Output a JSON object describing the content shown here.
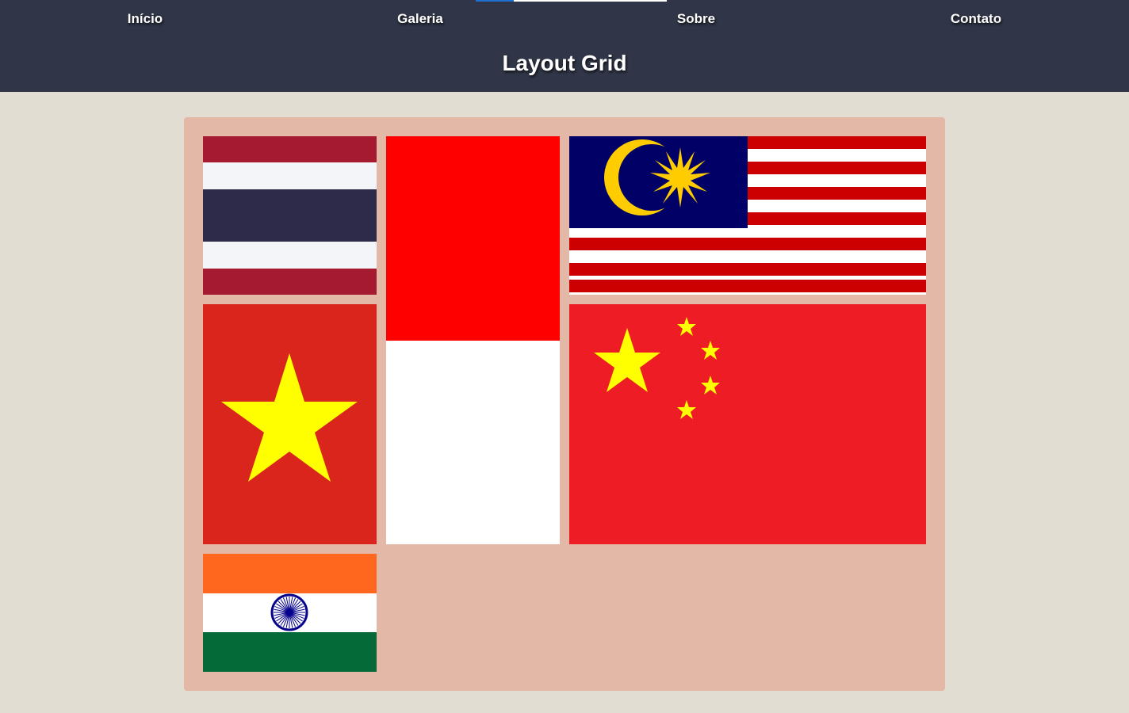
{
  "nav": {
    "items": [
      {
        "label": "Início"
      },
      {
        "label": "Galeria"
      },
      {
        "label": "Sobre"
      },
      {
        "label": "Contato"
      }
    ]
  },
  "page_title": "Layout Grid",
  "colors": {
    "header_bg": "#303647",
    "page_bg": "#e1ddd2",
    "grid_bg": "#e4b8a6"
  },
  "gallery": {
    "flags": [
      {
        "name": "thailand-flag"
      },
      {
        "name": "indonesia-flag"
      },
      {
        "name": "malaysia-flag"
      },
      {
        "name": "vietnam-flag"
      },
      {
        "name": "china-flag"
      },
      {
        "name": "india-flag"
      }
    ]
  }
}
